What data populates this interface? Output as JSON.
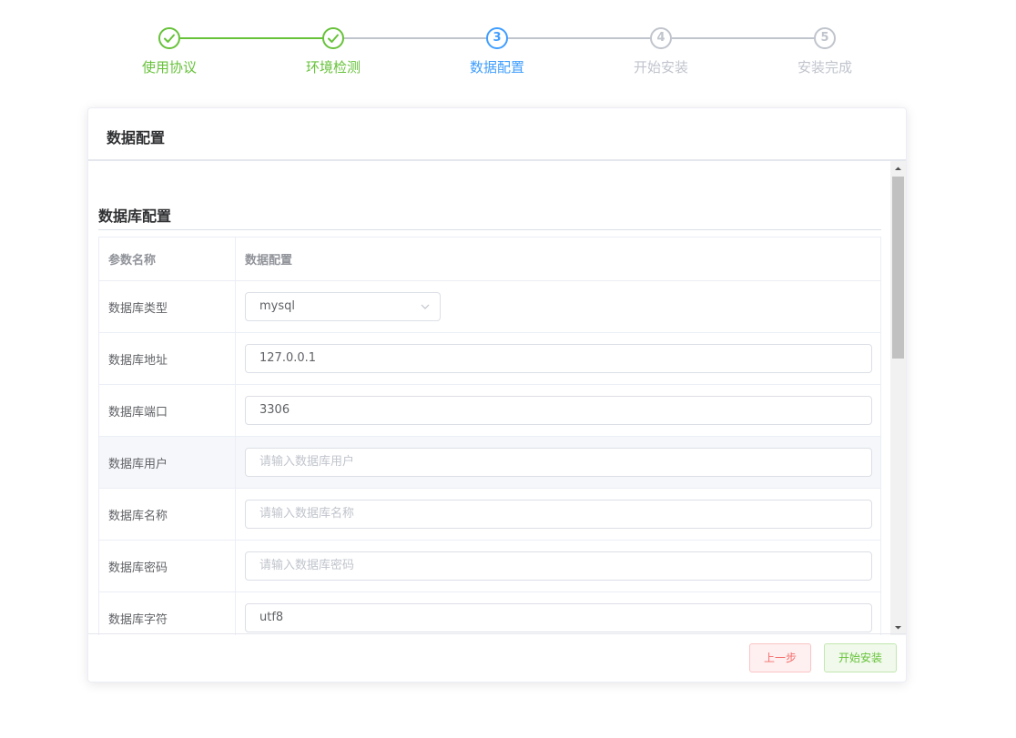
{
  "steps": [
    {
      "number": "1",
      "title": "使用协议",
      "status": "done"
    },
    {
      "number": "2",
      "title": "环境检测",
      "status": "done"
    },
    {
      "number": "3",
      "title": "数据配置",
      "status": "active"
    },
    {
      "number": "4",
      "title": "开始安装",
      "status": "wait"
    },
    {
      "number": "5",
      "title": "安装完成",
      "status": "wait"
    }
  ],
  "card": {
    "title": "数据配置",
    "section_title": "数据库配置",
    "table": {
      "headers": [
        "参数名称",
        "数据配置"
      ],
      "rows": [
        {
          "label": "数据库类型",
          "type": "select",
          "value": "mysql"
        },
        {
          "label": "数据库地址",
          "type": "input",
          "value": "127.0.0.1",
          "placeholder": ""
        },
        {
          "label": "数据库端口",
          "type": "input",
          "value": "3306",
          "placeholder": ""
        },
        {
          "label": "数据库用户",
          "type": "input",
          "value": "",
          "placeholder": "请输入数据库用户"
        },
        {
          "label": "数据库名称",
          "type": "input",
          "value": "",
          "placeholder": "请输入数据库名称"
        },
        {
          "label": "数据库密码",
          "type": "input",
          "value": "",
          "placeholder": "请输入数据库密码"
        },
        {
          "label": "数据库字符",
          "type": "input",
          "value": "utf8",
          "placeholder": ""
        }
      ]
    }
  },
  "footer": {
    "prev_label": "上一步",
    "start_label": "开始安装"
  },
  "colors": {
    "success": "#67c23a",
    "primary": "#409eff",
    "danger": "#f56c6c",
    "inactive": "#c0c4cc"
  }
}
